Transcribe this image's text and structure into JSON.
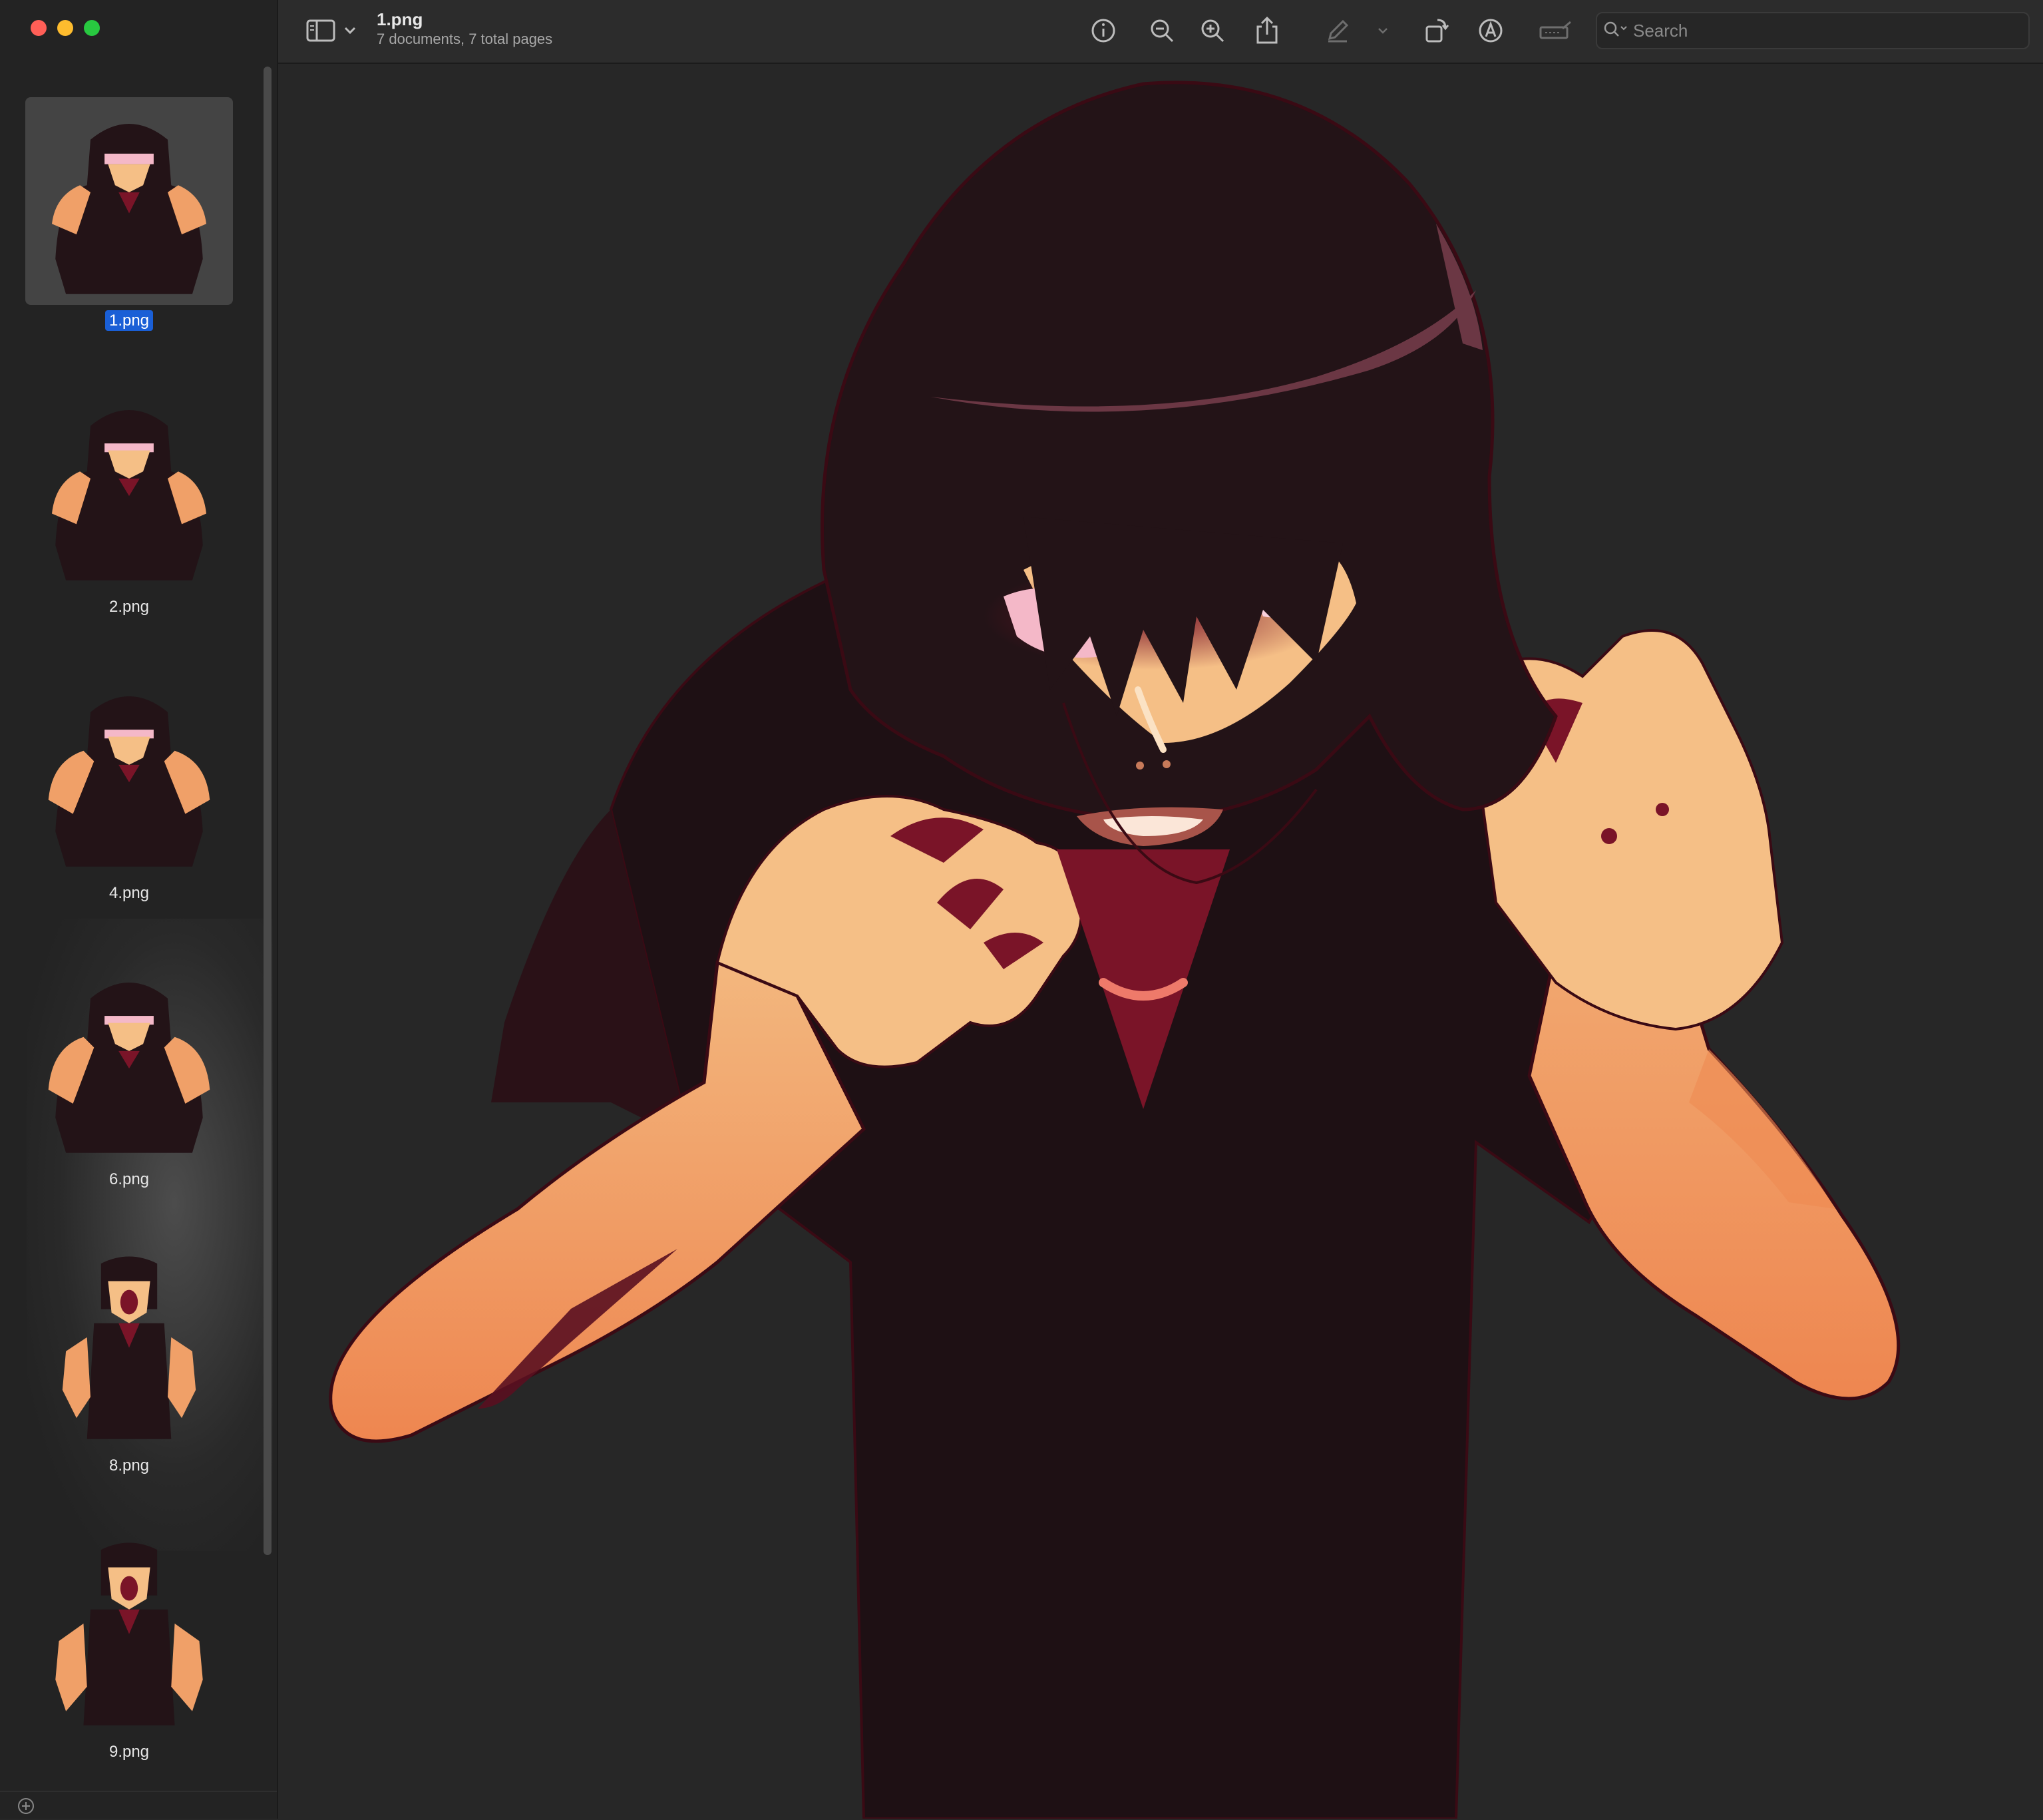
{
  "window": {
    "title": "1.png",
    "subtitle": "7 documents, 7 total pages"
  },
  "toolbar": {
    "buttons": [
      {
        "name": "sidebar-toggle-icon"
      },
      {
        "name": "chevron-down-icon"
      },
      {
        "name": "info-icon"
      },
      {
        "name": "zoom-out-icon"
      },
      {
        "name": "zoom-in-icon"
      },
      {
        "name": "share-icon"
      },
      {
        "name": "highlight-pen-icon"
      },
      {
        "name": "rotate-icon"
      },
      {
        "name": "markup-icon"
      },
      {
        "name": "redact-icon"
      }
    ],
    "search_placeholder": "Search"
  },
  "sidebar": {
    "thumbnails": [
      {
        "label": "1.png",
        "selected": true,
        "pose": "claw"
      },
      {
        "label": "2.png",
        "selected": false,
        "pose": "claw"
      },
      {
        "label": "4.png",
        "selected": false,
        "pose": "claw"
      },
      {
        "label": "6.png",
        "selected": false,
        "pose": "claw"
      },
      {
        "label": "8.png",
        "selected": false,
        "pose": "scream"
      },
      {
        "label": "9.png",
        "selected": false,
        "pose": "scream"
      }
    ]
  },
  "colors": {
    "close": "#ff5f57",
    "minimize": "#febc2e",
    "zoom": "#28c840",
    "selection": "#1a5fd6",
    "hair": "#231317",
    "skin": "#f5bf86",
    "skin_dark": "#ee8a52",
    "shirt": "#1e1014",
    "accent": "#7a1428",
    "eye_glow": "#f4b8c8"
  }
}
